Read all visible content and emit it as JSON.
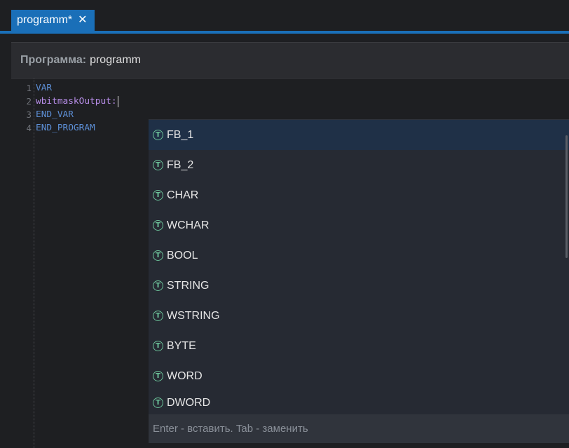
{
  "tabs": [
    {
      "label": "programm*",
      "close_glyph": "✕",
      "active": true
    }
  ],
  "header": {
    "label": "Программа:",
    "value": "programm"
  },
  "editor": {
    "lines": [
      {
        "num": "1",
        "text": "VAR",
        "kind": "keyword"
      },
      {
        "num": "2",
        "text": "wbitmaskOutput:",
        "kind": "identifier"
      },
      {
        "num": "3",
        "text": "END_VAR",
        "kind": "keyword"
      },
      {
        "num": "4",
        "text": "END_PROGRAM",
        "kind": "keyword"
      }
    ]
  },
  "suggestions": {
    "icon_glyph": "T",
    "icon_name": "type-icon",
    "selected_index": 0,
    "items": [
      "FB_1",
      "FB_2",
      "CHAR",
      "WCHAR",
      "BOOL",
      "STRING",
      "WSTRING",
      "BYTE",
      "WORD",
      "DWORD"
    ],
    "footer": "Enter - вставить. Tab -  заменить"
  },
  "colors": {
    "accent": "#1a6fb8",
    "keyword": "#5d8fd6",
    "identifier": "#b78de8",
    "type_icon": "#6cc39a",
    "background": "#1e1f22",
    "suggest_bg": "#262a33"
  }
}
